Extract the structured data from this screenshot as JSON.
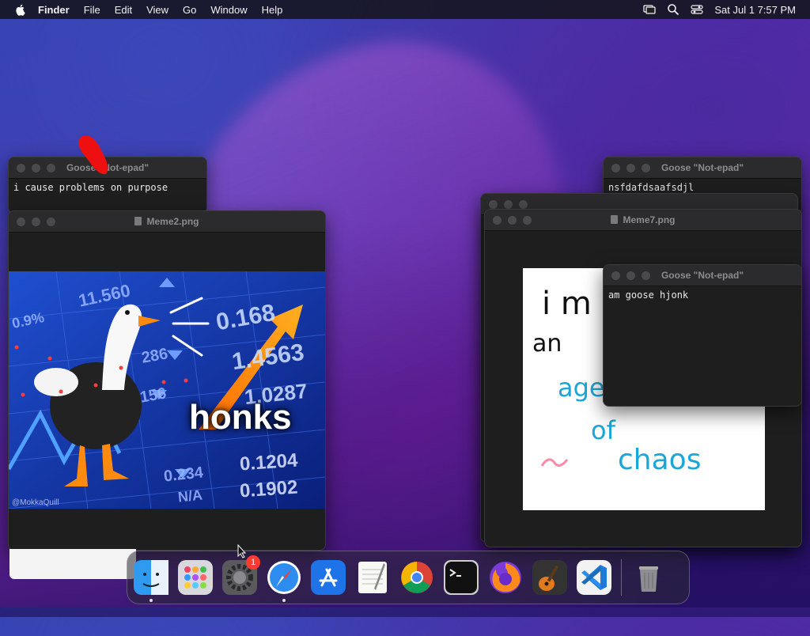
{
  "menubar": {
    "app_name": "Finder",
    "items": [
      "File",
      "Edit",
      "View",
      "Go",
      "Window",
      "Help"
    ],
    "datetime": "Sat Jul 1  7:57 PM"
  },
  "windows": {
    "notepad_left": {
      "title": "Goose \"Not-epad\"",
      "text": "i cause problems on purpose"
    },
    "meme2": {
      "title": "Meme2.png",
      "caption": "honks",
      "credit": "@MokkaQuill",
      "tickers": [
        "11.560",
        "0.9%",
        "0.168",
        "1.4563",
        "1.0287",
        "0.1204",
        "0.1902",
        "0.234",
        "N/A",
        "286",
        "156"
      ]
    },
    "notepad_right": {
      "title": "Goose \"Not-epad\"",
      "text": "nsfdafdsaafsdjl\nasdas      sorry\nhard to type withh feet"
    },
    "meme7": {
      "title": "Meme7.png",
      "lines": [
        "i m",
        "an",
        "age",
        "of",
        "chaos"
      ]
    },
    "notepad_front": {
      "title": "Goose \"Not-epad\"",
      "text": "am goose hjonk"
    }
  },
  "dock": {
    "apps": [
      "finder-icon",
      "launchpad-icon",
      "system-settings-icon",
      "safari-icon",
      "app-store-icon",
      "textedit-icon",
      "chrome-icon",
      "terminal-icon",
      "firefox-icon",
      "garageband-icon",
      "vscode-icon",
      "trash-icon"
    ],
    "settings_badge": "1"
  },
  "colors": {
    "menubar_bg": "#14141c",
    "window_bg": "#1e1e1e",
    "titlebar_bg": "#2b2b2d",
    "chaos_cyan": "#1aa7d8"
  }
}
